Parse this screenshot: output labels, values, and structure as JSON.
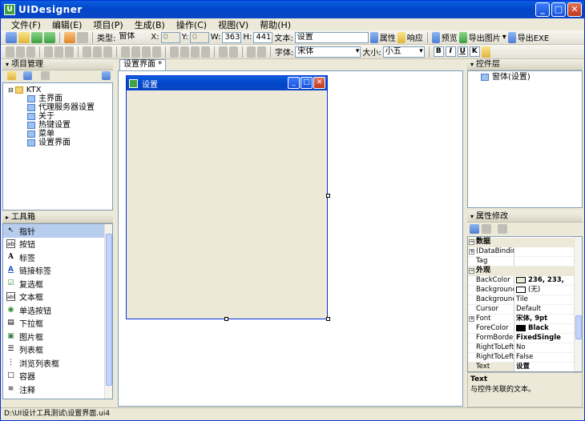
{
  "app": {
    "title": "UIDesigner",
    "status_path": "D:\\UI设计工具测试\\设置界面.ui4"
  },
  "title_buttons": {
    "min": "_",
    "max": "□",
    "close": "✕"
  },
  "menu": [
    "文件(F)",
    "编辑(E)",
    "项目(P)",
    "生成(B)",
    "操作(C)",
    "视图(V)",
    "帮助(H)"
  ],
  "toolbar1": {
    "type_label": "类型:",
    "type_value": "窗体",
    "x_label": "X:",
    "x_value": "0",
    "y_label": "Y:",
    "y_value": "0",
    "w_label": "W:",
    "w_value": "363",
    "h_label": "H:",
    "h_value": "441",
    "text_label": "文本:",
    "text_value": "设置",
    "prop_btn": "属性",
    "resp_btn": "响应",
    "preview_btn": "预览",
    "export_img_btn": "导出图片",
    "export_exe_btn": "导出EXE"
  },
  "toolbar2": {
    "font_label": "字体:",
    "font_value": "宋体",
    "size_label": "大小:",
    "size_value": "小五",
    "bold": "B",
    "italic": "I",
    "underline": "U",
    "k": "K"
  },
  "project_panel": {
    "title": "项目管理",
    "root": "KTX",
    "items": [
      "主界面",
      "代理服务器设置",
      "关于",
      "热键设置",
      "菜单",
      "设置界面"
    ]
  },
  "toolbox": {
    "title": "工具箱",
    "items": [
      {
        "label": "指针",
        "icon": "↖"
      },
      {
        "label": "按钮",
        "icon": "ab"
      },
      {
        "label": "标签",
        "icon": "A"
      },
      {
        "label": "链接标签",
        "icon": "A"
      },
      {
        "label": "复选框",
        "icon": "☑"
      },
      {
        "label": "文本框",
        "icon": "abl"
      },
      {
        "label": "单选按钮",
        "icon": "◉"
      },
      {
        "label": "下拉框",
        "icon": "▤"
      },
      {
        "label": "图片框",
        "icon": "▣"
      },
      {
        "label": "列表框",
        "icon": "☰"
      },
      {
        "label": "浏览列表框",
        "icon": "⋮"
      },
      {
        "label": "容器",
        "icon": "□"
      },
      {
        "label": "注释",
        "icon": "≡"
      }
    ]
  },
  "editor": {
    "tab_label": "设置界面 *",
    "form_title": "设置"
  },
  "controls_panel": {
    "title": "控件层",
    "items": [
      "窗体(设置)"
    ]
  },
  "props_panel": {
    "title": "属性修改",
    "categories": [
      {
        "name": "数据",
        "rows": [
          {
            "k": "(DataBindings",
            "v": "",
            "expand": true
          },
          {
            "k": "Tag",
            "v": ""
          }
        ]
      },
      {
        "name": "外观",
        "rows": [
          {
            "k": "BackColor",
            "v": "236, 233,",
            "swatch": "#ECE9D8"
          },
          {
            "k": "BackgroundIma",
            "v": "(无)",
            "swatch": "#FFFFFF"
          },
          {
            "k": "BackgroundIma",
            "v": "Tile"
          },
          {
            "k": "Cursor",
            "v": "Default"
          },
          {
            "k": "Font",
            "v": "宋体, 9pt",
            "expand": true,
            "bold": true
          },
          {
            "k": "ForeColor",
            "v": "Black",
            "swatch": "#000000",
            "bold": true
          },
          {
            "k": "FormBorderSty",
            "v": "FixedSingle",
            "bold": true
          },
          {
            "k": "RightToLeft",
            "v": "No"
          },
          {
            "k": "RightToLeftLa",
            "v": "False"
          },
          {
            "k": "Text",
            "v": "设置",
            "bold": true
          }
        ]
      }
    ],
    "desc_title": "Text",
    "desc_text": "与控件关联的文本。"
  }
}
